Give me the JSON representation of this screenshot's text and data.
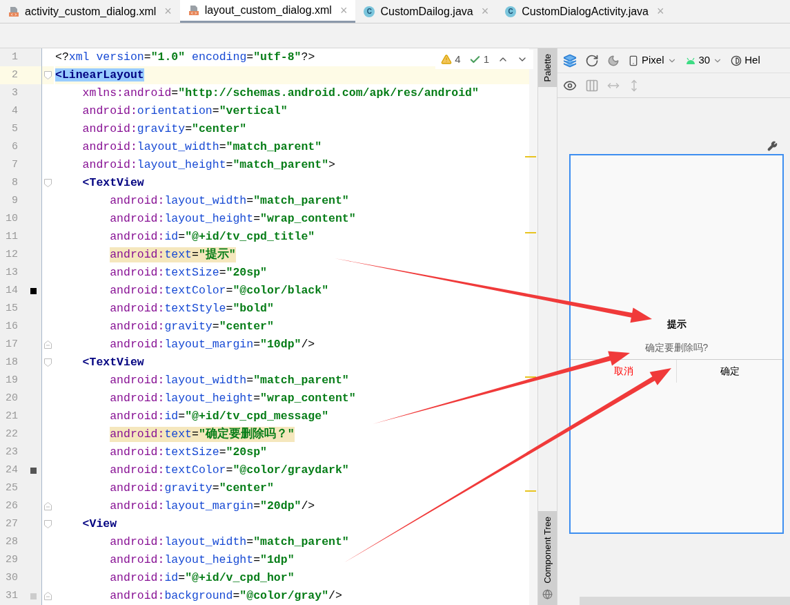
{
  "tabs": [
    {
      "label": "activity_custom_dialog.xml",
      "kind": "xml",
      "selected": false,
      "close": "×"
    },
    {
      "label": "layout_custom_dialog.xml",
      "kind": "xml",
      "selected": true,
      "close": "×"
    },
    {
      "label": "CustomDailog.java",
      "kind": "java",
      "badge": "C",
      "selected": false,
      "close": "×"
    },
    {
      "label": "CustomDialogActivity.java",
      "kind": "java",
      "badge": "C",
      "selected": false,
      "close": "×"
    }
  ],
  "editor": {
    "inspections": {
      "warnings": "4",
      "checks": "1"
    },
    "lines": [
      {
        "number": "1",
        "text": "<?xml version=\"1.0\" encoding=\"utf-8\"?>",
        "current": false,
        "tag_matched": false,
        "match_highlight": false,
        "fold_start": false,
        "fold_end": false
      },
      {
        "number": "2",
        "text": "<LinearLayout",
        "current": true,
        "tag_matched": true,
        "match_highlight": false,
        "fold_start": true,
        "fold_end": false
      },
      {
        "number": "3",
        "text": "xmlns:android=\"http://schemas.android.com/apk/res/android\"",
        "current": false,
        "tag_matched": false,
        "match_highlight": false,
        "fold_start": false,
        "fold_end": false
      },
      {
        "number": "4",
        "text": "android:orientation=\"vertical\"",
        "current": false,
        "tag_matched": false,
        "match_highlight": false,
        "fold_start": false,
        "fold_end": false
      },
      {
        "number": "5",
        "text": "android:gravity=\"center\"",
        "current": false,
        "tag_matched": false,
        "match_highlight": false,
        "fold_start": false,
        "fold_end": false
      },
      {
        "number": "6",
        "text": "android:layout_width=\"match_parent\"",
        "current": false,
        "tag_matched": false,
        "match_highlight": false,
        "fold_start": false,
        "fold_end": false
      },
      {
        "number": "7",
        "text": "android:layout_height=\"match_parent\">",
        "current": false,
        "tag_matched": false,
        "match_highlight": false,
        "fold_start": false,
        "fold_end": false
      },
      {
        "number": "8",
        "text": "<TextView",
        "current": false,
        "tag_matched": false,
        "match_highlight": false,
        "fold_start": true,
        "fold_end": false
      },
      {
        "number": "9",
        "text": "android:layout_width=\"match_parent\"",
        "current": false,
        "tag_matched": false,
        "match_highlight": false,
        "fold_start": false,
        "fold_end": false
      },
      {
        "number": "10",
        "text": "android:layout_height=\"wrap_content\"",
        "current": false,
        "tag_matched": false,
        "match_highlight": false,
        "fold_start": false,
        "fold_end": false
      },
      {
        "number": "11",
        "text": "android:id=\"@+id/tv_cpd_title\"",
        "current": false,
        "tag_matched": false,
        "match_highlight": false,
        "fold_start": false,
        "fold_end": false
      },
      {
        "number": "12",
        "text": "android:text=\"提示\"",
        "current": false,
        "tag_matched": false,
        "match_highlight": true,
        "fold_start": false,
        "fold_end": false
      },
      {
        "number": "13",
        "text": "android:textSize=\"20sp\"",
        "current": false,
        "tag_matched": false,
        "match_highlight": false,
        "fold_start": false,
        "fold_end": false
      },
      {
        "number": "14",
        "text": "android:textColor=\"@color/black\"",
        "current": false,
        "tag_matched": false,
        "match_highlight": false,
        "fold_start": false,
        "fold_end": false,
        "color": "#000000"
      },
      {
        "number": "15",
        "text": "android:textStyle=\"bold\"",
        "current": false,
        "tag_matched": false,
        "match_highlight": false,
        "fold_start": false,
        "fold_end": false
      },
      {
        "number": "16",
        "text": "android:gravity=\"center\"",
        "current": false,
        "tag_matched": false,
        "match_highlight": false,
        "fold_start": false,
        "fold_end": false
      },
      {
        "number": "17",
        "text": "android:layout_margin=\"10dp\"/>",
        "current": false,
        "tag_matched": false,
        "match_highlight": false,
        "fold_start": false,
        "fold_end": true
      },
      {
        "number": "18",
        "text": "<TextView",
        "current": false,
        "tag_matched": false,
        "match_highlight": false,
        "fold_start": true,
        "fold_end": false
      },
      {
        "number": "19",
        "text": "android:layout_width=\"match_parent\"",
        "current": false,
        "tag_matched": false,
        "match_highlight": false,
        "fold_start": false,
        "fold_end": false
      },
      {
        "number": "20",
        "text": "android:layout_height=\"wrap_content\"",
        "current": false,
        "tag_matched": false,
        "match_highlight": false,
        "fold_start": false,
        "fold_end": false
      },
      {
        "number": "21",
        "text": "android:id=\"@+id/tv_cpd_message\"",
        "current": false,
        "tag_matched": false,
        "match_highlight": false,
        "fold_start": false,
        "fold_end": false
      },
      {
        "number": "22",
        "text": "android:text=\"确定要删除吗？\"",
        "current": false,
        "tag_matched": false,
        "match_highlight": true,
        "fold_start": false,
        "fold_end": false
      },
      {
        "number": "23",
        "text": "android:textSize=\"20sp\"",
        "current": false,
        "tag_matched": false,
        "match_highlight": false,
        "fold_start": false,
        "fold_end": false
      },
      {
        "number": "24",
        "text": "android:textColor=\"@color/graydark\"",
        "current": false,
        "tag_matched": false,
        "match_highlight": false,
        "fold_start": false,
        "fold_end": false,
        "color": "#555555"
      },
      {
        "number": "25",
        "text": "android:gravity=\"center\"",
        "current": false,
        "tag_matched": false,
        "match_highlight": false,
        "fold_start": false,
        "fold_end": false
      },
      {
        "number": "26",
        "text": "android:layout_margin=\"20dp\"/>",
        "current": false,
        "tag_matched": false,
        "match_highlight": false,
        "fold_start": false,
        "fold_end": true
      },
      {
        "number": "27",
        "text": "<View",
        "current": false,
        "tag_matched": false,
        "match_highlight": false,
        "fold_start": true,
        "fold_end": false
      },
      {
        "number": "28",
        "text": "android:layout_width=\"match_parent\"",
        "current": false,
        "tag_matched": false,
        "match_highlight": false,
        "fold_start": false,
        "fold_end": false
      },
      {
        "number": "29",
        "text": "android:layout_height=\"1dp\"",
        "current": false,
        "tag_matched": false,
        "match_highlight": false,
        "fold_start": false,
        "fold_end": false
      },
      {
        "number": "30",
        "text": "android:id=\"@+id/v_cpd_hor\"",
        "current": false,
        "tag_matched": false,
        "match_highlight": false,
        "fold_start": false,
        "fold_end": false
      },
      {
        "number": "31",
        "text": "android:background=\"@color/gray\"/>",
        "current": false,
        "tag_matched": false,
        "match_highlight": false,
        "fold_start": false,
        "fold_end": true,
        "color": "#cccccc"
      }
    ]
  },
  "side_tabs": {
    "top": "Palette",
    "bottom": "Component Tree"
  },
  "design_toolbar": {
    "device": "Pixel",
    "api": "30",
    "theme": "Hel"
  },
  "preview": {
    "title": "提示",
    "message": "确定要删除吗?",
    "buttons": [
      {
        "label": "取消",
        "kind": "cancel"
      },
      {
        "label": "确定",
        "kind": "confirm"
      }
    ]
  }
}
